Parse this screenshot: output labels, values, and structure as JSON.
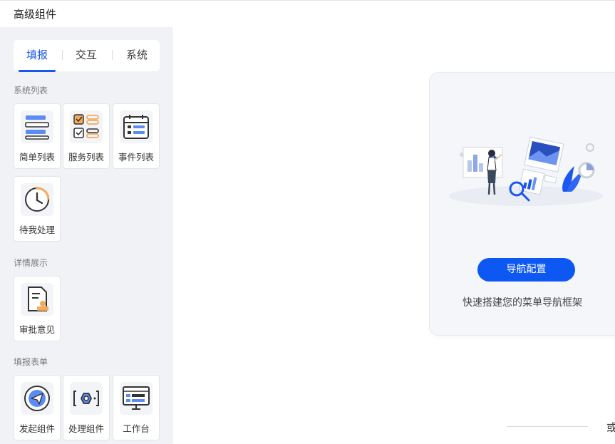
{
  "header": {
    "title": "高级组件"
  },
  "tabs": [
    {
      "label": "填报",
      "active": true
    },
    {
      "label": "交互",
      "active": false
    },
    {
      "label": "系统",
      "active": false
    }
  ],
  "sections": {
    "system_list": {
      "title": "系统列表",
      "items": [
        {
          "label": "简单列表",
          "icon": "list-icon"
        },
        {
          "label": "服务列表",
          "icon": "service-list-icon"
        },
        {
          "label": "事件列表",
          "icon": "event-calendar-icon"
        },
        {
          "label": "待我处理",
          "icon": "clock-icon"
        }
      ]
    },
    "detail_display": {
      "title": "详情展示",
      "items": [
        {
          "label": "审批意见",
          "icon": "approval-document-icon"
        }
      ]
    },
    "form": {
      "title": "填报表单",
      "items": [
        {
          "label": "发起组件",
          "icon": "send-icon"
        },
        {
          "label": "处理组件",
          "icon": "process-gear-icon"
        },
        {
          "label": "工作台",
          "icon": "workbench-monitor-icon"
        }
      ]
    }
  },
  "nav_config": {
    "button_label": "导航配置",
    "description": "快速搭建您的菜单导航框架"
  },
  "footer": {
    "or_text": "或"
  },
  "colors": {
    "accent": "#1a56f0",
    "button": "#0d57f2",
    "icon_blue": "#5b8cf5",
    "icon_orange": "#f5a95a"
  }
}
